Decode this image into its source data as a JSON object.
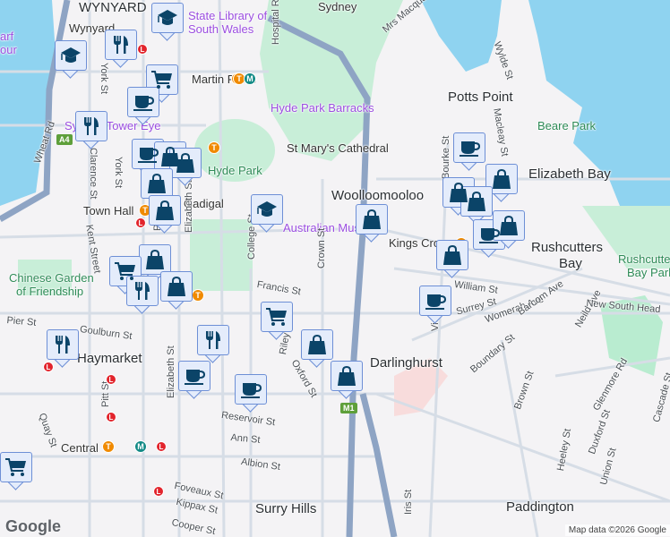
{
  "map": {
    "suburbs": [
      "WYNYARD",
      "Potts Point",
      "Elizabeth Bay",
      "Woolloomooloo",
      "Rushcutters",
      "Bay",
      "Darlinghurst",
      "Haymarket",
      "Surry Hills",
      "Paddington"
    ],
    "pois": [
      "State Library of",
      "South Wales",
      "Hyde Park Barracks",
      "St Mary's Cathedral",
      "Sydney Tower Eye",
      "Australian Museum",
      "Chinese Garden",
      "of Friendship",
      "arf",
      "our",
      "Sydney"
    ],
    "parks": [
      "Hyde Park",
      "Beare Park",
      "Rushcutters",
      "Bay Park"
    ],
    "stations": [
      "Wynyard",
      "Martin Place",
      "Town Hall",
      "Gadigal",
      "Central",
      "Kings Cross",
      "Museum"
    ],
    "streets": [
      "York St",
      "Hospital Rd",
      "Wheat Rd",
      "Clarence St",
      "York St",
      "Kent Street",
      "Pitt St",
      "Elizabeth St",
      "College St",
      "Francis St",
      "Crown St",
      "William St",
      "Surrey St",
      "Womerah Ave",
      "Barcom Ave",
      "Victoria St",
      "Boundary St",
      "Neild Ave",
      "New South Head",
      "Brown St",
      "Glenmore Rd",
      "Cascade St",
      "Heeley St",
      "Duxford St",
      "Union St",
      "Iris St",
      "Pier St",
      "Goulburn St",
      "Quay St",
      "Pitt St",
      "Elizabeth St",
      "Reservoir St",
      "Ann St",
      "Albion St",
      "Foveaux St",
      "Kippax St",
      "Cooper St",
      "Riley St",
      "Mrs Macquarie",
      "Wylde St",
      "Macleay St",
      "Oxford St",
      "Bourke St"
    ],
    "shields": [
      "A4",
      "M1"
    ],
    "markers": [
      "education",
      "restaurant",
      "education",
      "shopping-cart",
      "cafe",
      "restaurant",
      "cafe",
      "shopping",
      "shopping",
      "shopping",
      "shopping",
      "education",
      "shopping",
      "cafe",
      "shopping",
      "shopping",
      "shopping",
      "cafe",
      "shopping",
      "shopping",
      "shopping",
      "shopping-cart",
      "shopping",
      "restaurant",
      "cafe",
      "shopping-cart",
      "shopping",
      "restaurant",
      "restaurant",
      "cafe",
      "cafe",
      "shopping",
      "shopping-cart"
    ],
    "logo": "Google",
    "attribution": "Map data ©2026 Google"
  },
  "colors": {
    "water": "#8fd3f0",
    "park": "#b9ecd0",
    "marker_icon": "#0b4468",
    "marker_bg": "#e4ecfb"
  }
}
